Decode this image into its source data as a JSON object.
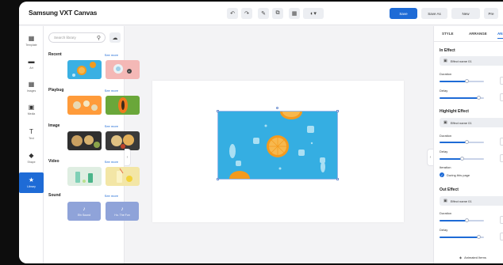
{
  "app": {
    "title": "Samsung VXT Canvas"
  },
  "toolbar": {
    "tools": [
      "↶",
      "↷",
      "✎",
      "⧉",
      "▦",
      "◐▾"
    ],
    "actions": [
      {
        "label": "Save",
        "primary": true,
        "width": 35
      },
      {
        "label": "Save As",
        "primary": false,
        "width": 33
      },
      {
        "label": "New",
        "primary": false,
        "width": 36
      },
      {
        "label": "Pre",
        "primary": false,
        "width": 18
      }
    ]
  },
  "rail": {
    "items": [
      {
        "icon": "▦",
        "label": "Template"
      },
      {
        "icon": "▬",
        "label": "Art"
      },
      {
        "icon": "▦",
        "label": "Images"
      },
      {
        "icon": "▣",
        "label": "Media"
      },
      {
        "icon": "T",
        "label": "Text"
      },
      {
        "icon": "◆",
        "label": "Shape"
      },
      {
        "icon": "★",
        "label": "Library",
        "active": true
      }
    ]
  },
  "library": {
    "search_placeholder": "Search library",
    "see_more": "See more",
    "sections": [
      {
        "title": "Recent"
      },
      {
        "title": "Playbug"
      },
      {
        "title": "Image"
      },
      {
        "title": "Video"
      },
      {
        "title": "Sound"
      }
    ],
    "sounds": [
      {
        "label": "Efx Sound"
      },
      {
        "label": "Ho. The Fun"
      }
    ]
  },
  "right_panel": {
    "tabs": [
      "STYLE",
      "ARRANGE",
      "AN"
    ],
    "in_effect": {
      "title": "In Effect",
      "value": "Effect name 01"
    },
    "duration_label": "Duration",
    "delay_label": "Delay",
    "highlight_effect": {
      "title": "Highlight Effect",
      "value": "Effect name 01"
    },
    "iteration_label": "Iteration",
    "iteration_option": "During this page",
    "out_effect": {
      "title": "Out Effect",
      "value": "Effect name 01"
    },
    "animated_items": "Animated Items",
    "sliders": {
      "in_duration": 0.62,
      "in_delay": 0.88,
      "hl_duration": 0.62,
      "hl_delay": 0.5,
      "out_duration": 0.62,
      "out_delay": 0.88
    }
  },
  "colors": {
    "accent": "#1e6bd6",
    "canvas_bg": "#ffffff",
    "water": "#35aee2",
    "orange": "#f39a1e"
  }
}
